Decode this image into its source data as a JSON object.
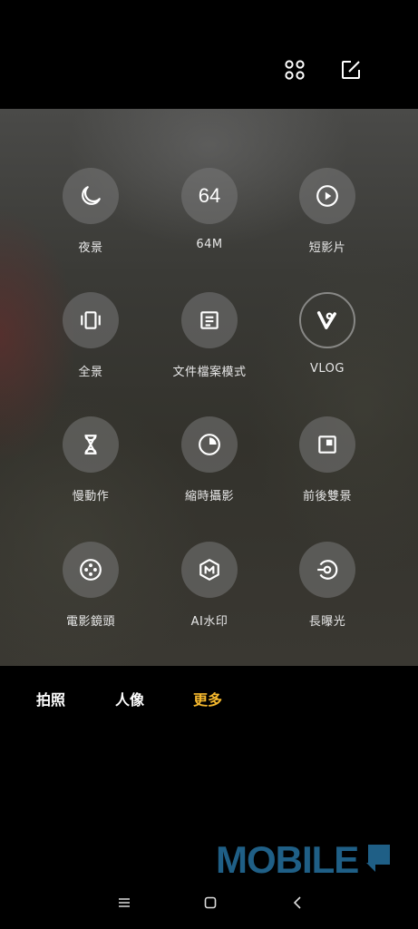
{
  "top_actions": {
    "grid_icon": "grid-icon",
    "edit_icon": "edit-icon"
  },
  "modes": [
    {
      "label": "夜景",
      "icon": "moon-icon"
    },
    {
      "label": "64M",
      "icon": "64",
      "icon_text": "64"
    },
    {
      "label": "短影片",
      "icon": "play-icon"
    },
    {
      "label": "全景",
      "icon": "panorama-icon"
    },
    {
      "label": "文件檔案模式",
      "icon": "document-icon"
    },
    {
      "label": "VLOG",
      "icon": "vlog-icon"
    },
    {
      "label": "慢動作",
      "icon": "hourglass-icon"
    },
    {
      "label": "縮時攝影",
      "icon": "timelapse-icon"
    },
    {
      "label": "前後雙景",
      "icon": "dual-view-icon"
    },
    {
      "label": "電影鏡頭",
      "icon": "film-reel-icon"
    },
    {
      "label": "AI水印",
      "icon": "watermark-icon"
    },
    {
      "label": "長曝光",
      "icon": "long-exposure-icon"
    }
  ],
  "tabs": [
    {
      "label": "拍照",
      "active": false
    },
    {
      "label": "人像",
      "active": false
    },
    {
      "label": "更多",
      "active": true
    }
  ],
  "watermark": {
    "text": "MOBILE"
  },
  "colors": {
    "accent": "#f5b82e",
    "watermark": "#1f5f86"
  }
}
